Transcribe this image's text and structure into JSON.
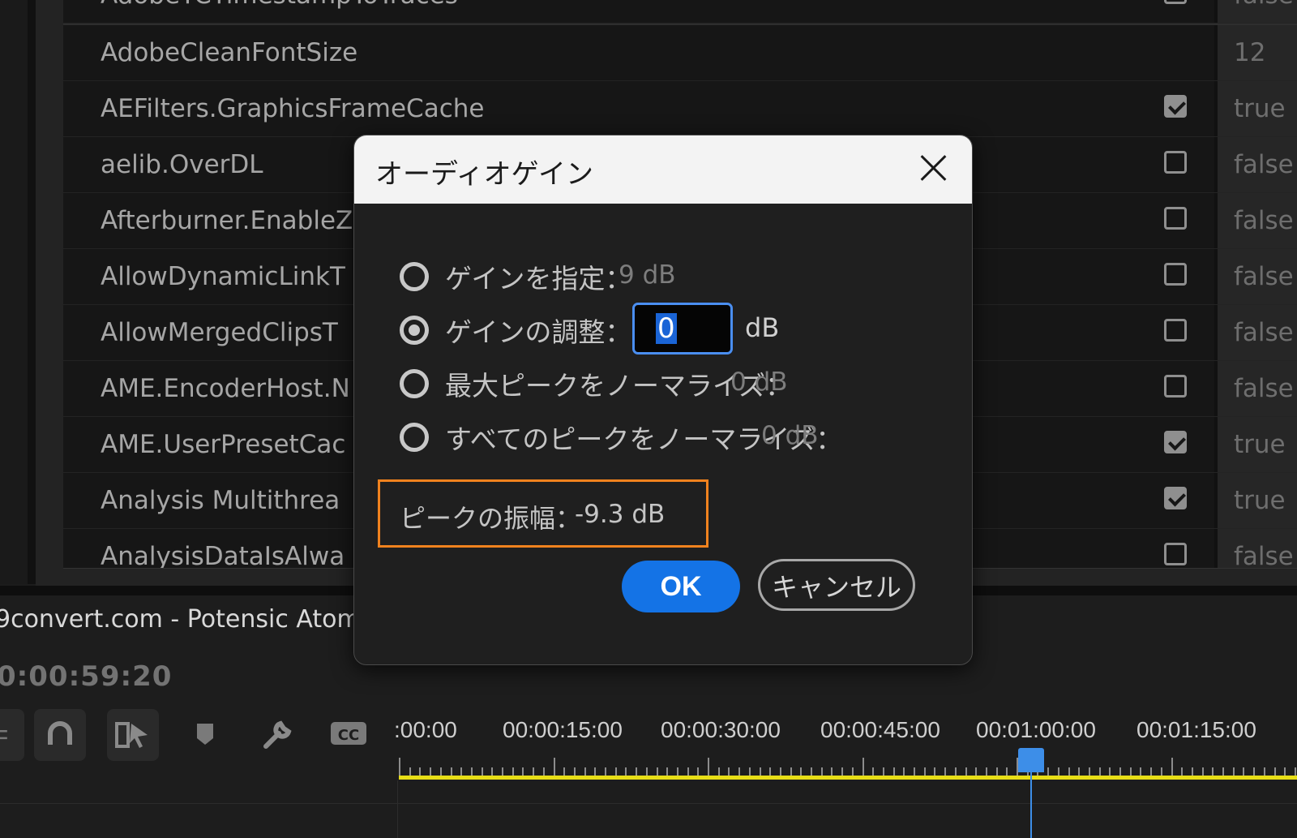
{
  "prefs": {
    "rows": [
      {
        "name": "AdobeTCTimestampToTraces",
        "checkbox": "unchecked",
        "value": "false"
      },
      {
        "name": "AdobeCleanFontSize",
        "checkbox": "none",
        "value": "12"
      },
      {
        "name": "AEFilters.GraphicsFrameCache",
        "checkbox": "checked",
        "value": "true"
      },
      {
        "name": "aelib.OverDL",
        "checkbox": "unchecked",
        "value": "false"
      },
      {
        "name": "Afterburner.EnableZ",
        "checkbox": "unchecked",
        "value": "false"
      },
      {
        "name": "AllowDynamicLinkT",
        "checkbox": "unchecked",
        "value": "false"
      },
      {
        "name": "AllowMergedClipsT",
        "checkbox": "unchecked",
        "value": "false"
      },
      {
        "name": "AME.EncoderHost.N",
        "checkbox": "unchecked",
        "value": "false"
      },
      {
        "name": "AME.UserPresetCac",
        "checkbox": "checked",
        "value": "true"
      },
      {
        "name": "Analysis Multithrea",
        "checkbox": "checked",
        "value": "true"
      },
      {
        "name": "AnalysisDataIsAlwa",
        "checkbox": "unchecked",
        "value": "false"
      }
    ]
  },
  "timeline": {
    "sequence_title": "9convert.com - Potensic Atom",
    "timecode": "0:00:59:20",
    "ruler_labels": [
      ":00:00",
      "00:00:15:00",
      "00:00:30:00",
      "00:00:45:00",
      "00:01:00:00",
      "00:01:15:00"
    ]
  },
  "dialog": {
    "title": "オーディオゲイン",
    "options": [
      {
        "label": "ゲインを指定：",
        "value": "9 dB",
        "selected": false
      },
      {
        "label": "ゲインの調整：",
        "value": "",
        "selected": true
      },
      {
        "label": "最大ピークをノーマライズ：",
        "value": "0 dB",
        "selected": false
      },
      {
        "label": "すべてのピークをノーマライズ：",
        "value": "0 dB",
        "selected": false
      }
    ],
    "gain_input_value": "0",
    "gain_unit": "dB",
    "peak_label": "ピークの振幅：",
    "peak_value": "-9.3 dB",
    "ok_label": "OK",
    "cancel_label": "キャンセル"
  },
  "colors": {
    "accent_blue": "#1473e6",
    "highlight_orange": "#f0821e",
    "work_area_yellow": "#e8de16",
    "playhead_blue": "#3d8ee8"
  }
}
